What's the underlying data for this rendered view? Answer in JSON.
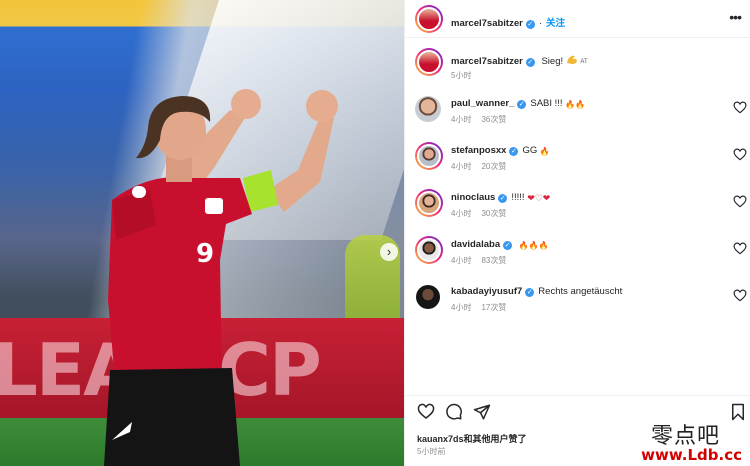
{
  "post": {
    "author": "marcel7sabitzer",
    "follow_label": "关注",
    "caption": "Sieg!",
    "caption_time": "5小时"
  },
  "photo": {
    "board_text": "LEAN CP",
    "accent_red": "#c8102e",
    "armband_color": "#a6e22e"
  },
  "comments": [
    {
      "user": "paul_wanner_",
      "text": "SABI !!!",
      "emoji": "🔥🔥",
      "time": "4小时",
      "likes": "36次赞"
    },
    {
      "user": "stefanposxx",
      "text": "GG",
      "emoji": "🔥",
      "time": "4小时",
      "likes": "20次赞"
    },
    {
      "user": "ninoclaus",
      "text": "!!!!!",
      "emoji": "❤♡❤",
      "time": "4小时",
      "likes": "30次赞"
    },
    {
      "user": "davidalaba",
      "text": "",
      "emoji": "🔥🔥🔥",
      "time": "4小时",
      "likes": "83次赞"
    },
    {
      "user": "kabadayiyusuf7",
      "text": "Rechts angetäuscht",
      "emoji": "",
      "time": "4小时",
      "likes": "17次赞"
    }
  ],
  "footer": {
    "liked_by": "kauanx7ds和其他用户赞了",
    "post_time": "5小时前"
  },
  "watermark": {
    "cn": "零点吧",
    "url": "www.Ldb.cc"
  }
}
